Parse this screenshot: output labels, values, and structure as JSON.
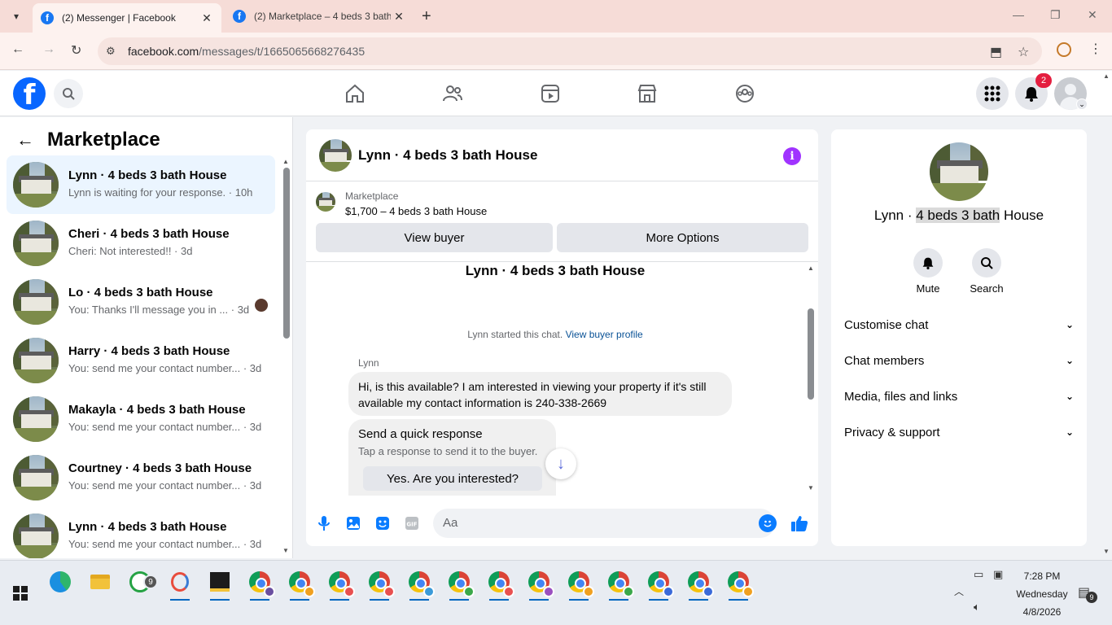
{
  "browser": {
    "tabs": [
      {
        "title": "(2) Messenger | Facebook",
        "active": true
      },
      {
        "title": "(2) Marketplace – 4 beds 3 bath",
        "active": false
      }
    ],
    "url_host": "facebook.com",
    "url_path": "/messages/t/1665065668276435",
    "new_tab": "+",
    "close_glyph": "✕"
  },
  "facebook": {
    "notification_count": "2",
    "nav_icons": [
      "home-icon",
      "friends-icon",
      "video-icon",
      "marketplace-icon",
      "groups-icon"
    ]
  },
  "left_panel": {
    "title": "Marketplace",
    "conversations": [
      {
        "name": "Lynn · 4 beds 3 bath House",
        "preview": "Lynn is waiting for your response. · 10h",
        "selected": true
      },
      {
        "name": "Cheri · 4 beds 3 bath House",
        "preview": "Cheri: Not interested!! · 3d"
      },
      {
        "name": "Lo · 4 beds 3 bath House",
        "preview": "You: Thanks I'll message you in ... · 3d"
      },
      {
        "name": "Harry · 4 beds 3 bath House",
        "preview": "You: send me your contact number... · 3d"
      },
      {
        "name": "Makayla · 4 beds 3 bath House",
        "preview": "You: send me your contact number... · 3d"
      },
      {
        "name": "Courtney · 4 beds 3 bath House",
        "preview": "You: send me your contact number... · 3d"
      },
      {
        "name": "Lynn · 4 beds 3 bath House",
        "preview": "You: send me your contact number... · 3d"
      }
    ]
  },
  "chat": {
    "title": "Lynn · 4 beds 3 bath House",
    "marketplace_label": "Marketplace",
    "listing": "$1,700 – 4 beds 3 bath House",
    "view_buyer": "View buyer",
    "more_options": "More Options",
    "thread_name": "Lynn · 4 beds 3 bath House",
    "started_text": "Lynn started this chat.",
    "view_profile_link": "View buyer profile",
    "sender": "Lynn",
    "message": "Hi, is this available? I am interested in viewing your property if it's still available my contact information is 240-338-2669",
    "quick_title": "Send a quick response",
    "quick_sub": "Tap a response to send it to the buyer.",
    "quick_reply": "Yes. Are you interested?",
    "composer_placeholder": "Aa"
  },
  "right_panel": {
    "name_prefix": "Lynn · ",
    "name_highlight": "4 beds 3 bath",
    "name_suffix": " House",
    "mute": "Mute",
    "search": "Search",
    "sections": [
      "Customise chat",
      "Chat members",
      "Media, files and links",
      "Privacy & support"
    ]
  },
  "taskbar": {
    "whatsapp_badge": "9",
    "time": "7:28 PM",
    "day": "Wednesday",
    "date": "4/8/2026",
    "notification_count": "9",
    "chrome_profile_colors": [
      "#6a4fa0",
      "#f0a020",
      "#e85050",
      "#e85050",
      "#3a9ad9",
      "#3aa84a",
      "#e85050",
      "#9a4fc0",
      "#f0a020",
      "#3aa84a",
      "#3a6ad9",
      "#3a6ad9",
      "#f0a020"
    ]
  },
  "colors": {
    "fb_blue": "#0866ff",
    "selected_row": "#ebf5ff",
    "info_purple": "#a033ff",
    "badge_red": "#e41e3f"
  }
}
